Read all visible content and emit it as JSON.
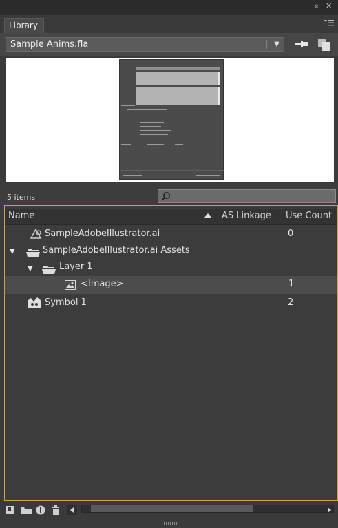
{
  "window": {
    "collapse_glyph": "«",
    "close_glyph": "✕"
  },
  "panel": {
    "tab_label": "Library",
    "menu_icon": "panel-menu-icon"
  },
  "document": {
    "selected": "Sample Anims.fla"
  },
  "items_count": "5 items",
  "search": {
    "placeholder": "",
    "value": ""
  },
  "columns": {
    "name": "Name",
    "linkage": "AS Linkage",
    "use_count": "Use Count"
  },
  "rows": [
    {
      "name": "SampleAdobeIllustrator.ai",
      "use_count": "0",
      "icon": "illustrator-symbol-icon",
      "expand": ""
    },
    {
      "name": "SampleAdobeIllustrator.ai Assets",
      "use_count": "",
      "icon": "folder-icon",
      "expand": "▼"
    },
    {
      "name": "Layer 1",
      "use_count": "",
      "icon": "folder-icon",
      "expand": "▼"
    },
    {
      "name": "<Image>",
      "use_count": "1",
      "icon": "bitmap-icon",
      "expand": ""
    },
    {
      "name": "Symbol 1",
      "use_count": "2",
      "icon": "movieclip-symbol-icon",
      "expand": ""
    }
  ],
  "colors": {
    "selection_highlight": "#c9a54a",
    "panel_bg": "#3b3b3b"
  }
}
